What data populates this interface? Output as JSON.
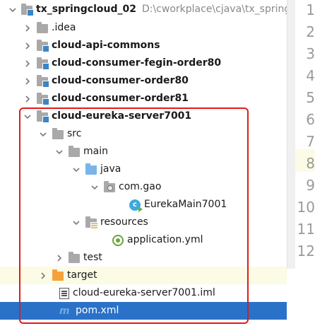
{
  "project": {
    "name": "tx_springcloud_02",
    "path": "D:\\cworkplace\\cjava\\tx_springc"
  },
  "tree": [
    {
      "label": ".idea"
    },
    {
      "label": "cloud-api-commons"
    },
    {
      "label": "cloud-consumer-fegin-order80"
    },
    {
      "label": "cloud-consumer-order80"
    },
    {
      "label": "cloud-consumer-order81"
    },
    {
      "label": "cloud-eureka-server7001"
    },
    {
      "label": "src"
    },
    {
      "label": "main"
    },
    {
      "label": "java"
    },
    {
      "label": "com.gao"
    },
    {
      "label": "EurekaMain7001"
    },
    {
      "label": "resources"
    },
    {
      "label": "application.yml"
    },
    {
      "label": "test"
    },
    {
      "label": "target"
    },
    {
      "label": "cloud-eureka-server7001.iml"
    },
    {
      "label": "pom.xml"
    }
  ],
  "icons": {
    "pom": "m"
  },
  "gutter": [
    "1",
    "2",
    "3",
    "4",
    "5",
    "6",
    "7",
    "8",
    "9",
    "10",
    "11",
    "12"
  ],
  "colors": {
    "selection": "#2a72c8",
    "highlight": "#fbfbe6",
    "annotation": "#e01b1b"
  }
}
